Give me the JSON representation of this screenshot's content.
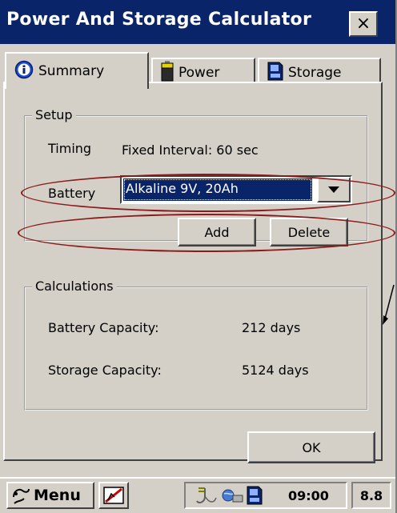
{
  "window": {
    "title": "Power And Storage Calculator",
    "close_label": "×"
  },
  "tabs": [
    {
      "label": "Summary",
      "icon": "info-icon",
      "active": true
    },
    {
      "label": "Power",
      "icon": "battery-icon",
      "active": false
    },
    {
      "label": "Storage",
      "icon": "storage-card-icon",
      "active": false
    }
  ],
  "setup": {
    "legend": "Setup",
    "timing_label": "Timing",
    "timing_value": "Fixed Interval: 60 sec",
    "battery_label": "Battery",
    "battery_selected": "Alkaline 9V, 20Ah",
    "add_label": "Add",
    "delete_label": "Delete"
  },
  "calculations": {
    "legend": "Calculations",
    "battery_capacity_label": "Battery Capacity:",
    "battery_capacity_value": "212 days",
    "storage_capacity_label": "Storage Capacity:",
    "storage_capacity_value": "5124 days"
  },
  "ok_label": "OK",
  "taskbar": {
    "menu_label": "Menu",
    "clock": "09:00",
    "version": "8.8"
  },
  "colors": {
    "title_bar": "#0a246a",
    "face": "#d4d0c8",
    "annotation": "#8b1a1a"
  }
}
